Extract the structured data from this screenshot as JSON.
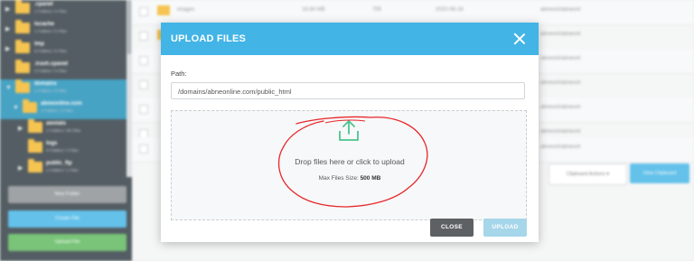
{
  "sidebar": {
    "tree": [
      {
        "name": ".cpanel",
        "sub": "1 Folders / 4 Files"
      },
      {
        "name": "lscache",
        "sub": "1 Folders / 0 Files"
      },
      {
        "name": "tmp",
        "sub": "6 Folders / 0 Files"
      },
      {
        "name": ".trash.cpanel",
        "sub": "0 Folders / 0 Files"
      },
      {
        "name": "domains",
        "sub": "1 Folders / 0 Files"
      },
      {
        "name": "abneonline.com",
        "sub": "2 Folders / 0 Files"
      },
      {
        "name": "awstats",
        "sub": "1 Folders / 46 Files"
      },
      {
        "name": "logs",
        "sub": "0 Folders / 3 Files"
      },
      {
        "name": "public_ftp",
        "sub": "1 Folders / 1 Files"
      }
    ],
    "buttons": {
      "new_folder": "New Folder",
      "create_file": "Create File",
      "upload_file": "Upload File"
    }
  },
  "file_list": {
    "rows": [
      {
        "name": "images",
        "size": "18.84 MB",
        "perms": "755",
        "date": "2020-06-16",
        "owner": "abneonl/abneonl"
      },
      {
        "name": "",
        "size": "",
        "perms": "",
        "date": "",
        "owner": "abneonl/abneonl"
      },
      {
        "name": "",
        "size": "",
        "perms": "",
        "date": "",
        "owner": "abneonl/abneonl"
      },
      {
        "name": "",
        "size": "",
        "perms": "",
        "date": "",
        "owner": "abneonl/abneonl"
      },
      {
        "name": "",
        "size": "",
        "perms": "",
        "date": "",
        "owner": "abneonl/abneonl"
      },
      {
        "name": "",
        "size": "",
        "perms": "",
        "date": "",
        "owner": "abneonl/abneonl"
      },
      {
        "name": "",
        "size": "",
        "perms": "",
        "date": "",
        "owner": "abneonl/abneonl"
      }
    ],
    "clipboard_actions": "Clipboard Actions",
    "view_clipboard": "View Clipboard"
  },
  "modal": {
    "title": "UPLOAD FILES",
    "path_label": "Path:",
    "path_value": "/domains/abneonline.com/public_html",
    "drop_text": "Drop files here or click to upload",
    "max_size_label": "Max Files Size:",
    "max_size_value": "500 MB",
    "close_label": "CLOSE",
    "upload_label": "UPLOAD"
  },
  "colors": {
    "header_blue": "#42b4e6",
    "annotation_red": "#e8262a",
    "upload_icon_green": "#4cc28f",
    "close_button": "#5e6163"
  },
  "icons": [
    "close-icon",
    "upload-icon",
    "folder-icon",
    "caret-down-icon"
  ]
}
